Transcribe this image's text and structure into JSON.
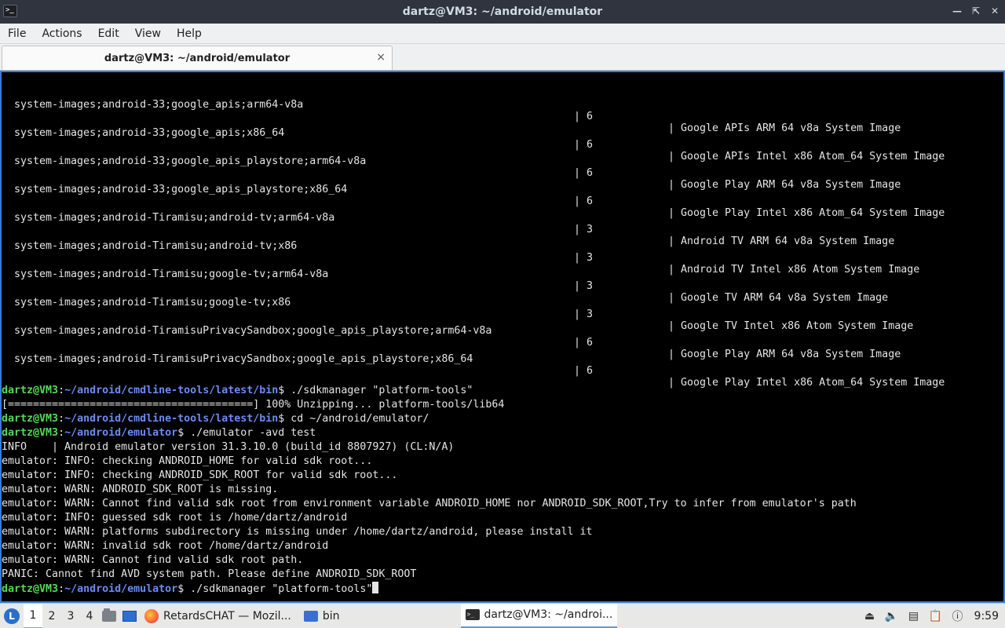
{
  "window": {
    "title": "dartz@VM3: ~/android/emulator",
    "app_icon": "terminal-icon",
    "controls": [
      "minimize",
      "maximize",
      "close"
    ]
  },
  "menu": {
    "items": [
      "File",
      "Actions",
      "Edit",
      "View",
      "Help"
    ]
  },
  "tab": {
    "label": "dartz@VM3: ~/android/emulator",
    "close": "×"
  },
  "packages": [
    {
      "path": "system-images;android-33;google_apis;arm64-v8a",
      "version": "| 6",
      "description": "| Google APIs ARM 64 v8a System Image"
    },
    {
      "path": "system-images;android-33;google_apis;x86_64",
      "version": "| 6",
      "description": "| Google APIs Intel x86 Atom_64 System Image"
    },
    {
      "path": "system-images;android-33;google_apis_playstore;arm64-v8a",
      "version": "| 6",
      "description": "| Google Play ARM 64 v8a System Image"
    },
    {
      "path": "system-images;android-33;google_apis_playstore;x86_64",
      "version": "| 6",
      "description": "| Google Play Intel x86 Atom_64 System Image"
    },
    {
      "path": "system-images;android-Tiramisu;android-tv;arm64-v8a",
      "version": "| 3",
      "description": "| Android TV ARM 64 v8a System Image"
    },
    {
      "path": "system-images;android-Tiramisu;android-tv;x86",
      "version": "| 3",
      "description": "| Android TV Intel x86 Atom System Image"
    },
    {
      "path": "system-images;android-Tiramisu;google-tv;arm64-v8a",
      "version": "| 3",
      "description": "| Google TV ARM 64 v8a System Image"
    },
    {
      "path": "system-images;android-Tiramisu;google-tv;x86",
      "version": "| 3",
      "description": "| Google TV Intel x86 Atom System Image"
    },
    {
      "path": "system-images;android-TiramisuPrivacySandbox;google_apis_playstore;arm64-v8a",
      "version": "| 6",
      "description": "| Google Play ARM 64 v8a System Image"
    },
    {
      "path": "system-images;android-TiramisuPrivacySandbox;google_apis_playstore;x86_64",
      "version": "| 6",
      "description": "| Google Play Intel x86 Atom_64 System Image"
    }
  ],
  "session": {
    "prompt_user": "dartz@VM3",
    "prompt_sep1": ":",
    "prompt_sep2": "$ ",
    "cmd1": {
      "path": "~/android/cmdline-tools/latest/bin",
      "command": "./sdkmanager \"platform-tools\""
    },
    "progress_line": "[=======================================] 100% Unzipping... platform-tools/lib64",
    "cmd2": {
      "path": "~/android/cmdline-tools/latest/bin",
      "command": "cd ~/android/emulator/"
    },
    "cmd3": {
      "path": "~/android/emulator",
      "command": "./emulator -avd test"
    },
    "output": [
      "INFO    | Android emulator version 31.3.10.0 (build_id 8807927) (CL:N/A)",
      "emulator: INFO: checking ANDROID_HOME for valid sdk root...",
      "emulator: INFO: checking ANDROID_SDK_ROOT for valid sdk root...",
      "emulator: WARN: ANDROID_SDK_ROOT is missing.",
      "emulator: WARN: Cannot find valid sdk root from environment variable ANDROID_HOME nor ANDROID_SDK_ROOT,Try to infer from emulator's path",
      "emulator: INFO: guessed sdk root is /home/dartz/android",
      "emulator: WARN: platforms subdirectory is missing under /home/dartz/android, please install it",
      "emulator: WARN: invalid sdk root /home/dartz/android",
      "emulator: WARN: Cannot find valid sdk root path.",
      "PANIC: Cannot find AVD system path. Please define ANDROID_SDK_ROOT"
    ],
    "cmd4": {
      "path": "~/android/emulator",
      "command": "./sdkmanager \"platform-tools\""
    }
  },
  "taskbar": {
    "workspaces": [
      "1",
      "2",
      "3",
      "4"
    ],
    "active_workspace": "1",
    "tasks": [
      {
        "icon": "firefox-icon",
        "label": "RetardsCHAT — Mozil..."
      },
      {
        "icon": "folder-icon",
        "label": "bin"
      },
      {
        "icon": "terminal-icon",
        "label": "dartz@VM3: ~/androi..."
      }
    ],
    "clock": "9:59",
    "tray_icons": [
      "eject-icon",
      "volume-icon",
      "display-icon",
      "clipboard-icon",
      "network-icon"
    ]
  }
}
